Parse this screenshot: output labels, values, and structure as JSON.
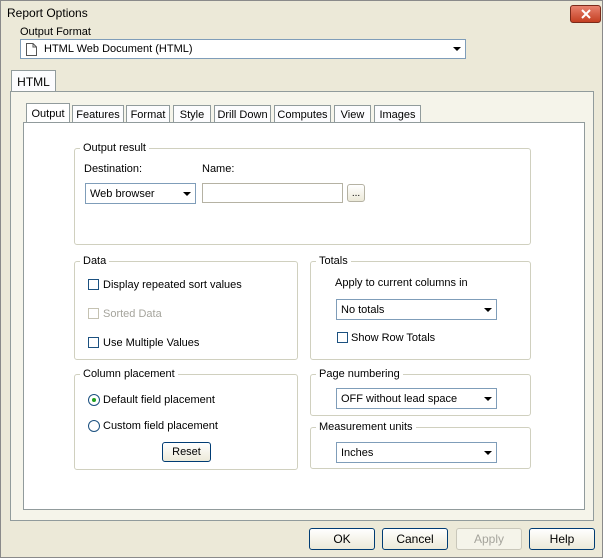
{
  "window": {
    "title": "Report Options"
  },
  "output_format": {
    "label": "Output Format",
    "value": "HTML Web Document (HTML)"
  },
  "main_tab": {
    "label": "HTML"
  },
  "sub_tabs": [
    "Output",
    "Features",
    "Format",
    "Style",
    "Drill Down",
    "Computes",
    "View",
    "Images"
  ],
  "output_result": {
    "title": "Output result",
    "destination_label": "Destination:",
    "destination_value": "Web browser",
    "name_label": "Name:",
    "name_value": "",
    "browse_label": "..."
  },
  "data_group": {
    "title": "Data",
    "display_repeated": "Display repeated sort values",
    "sorted_data": "Sorted Data",
    "use_multiple": "Use Multiple Values"
  },
  "totals": {
    "title": "Totals",
    "apply_label": "Apply to current columns in",
    "value": "No totals",
    "show_row_totals": "Show Row Totals"
  },
  "column_placement": {
    "title": "Column placement",
    "default_option": "Default field placement",
    "custom_option": "Custom field placement",
    "reset_label": "Reset"
  },
  "page_numbering": {
    "title": "Page numbering",
    "value": "OFF without lead space"
  },
  "measurement_units": {
    "title": "Measurement units",
    "value": "Inches"
  },
  "buttons": {
    "ok": "OK",
    "cancel": "Cancel",
    "apply": "Apply",
    "help": "Help"
  },
  "icons": {
    "close": "close-icon",
    "document": "document-icon"
  }
}
